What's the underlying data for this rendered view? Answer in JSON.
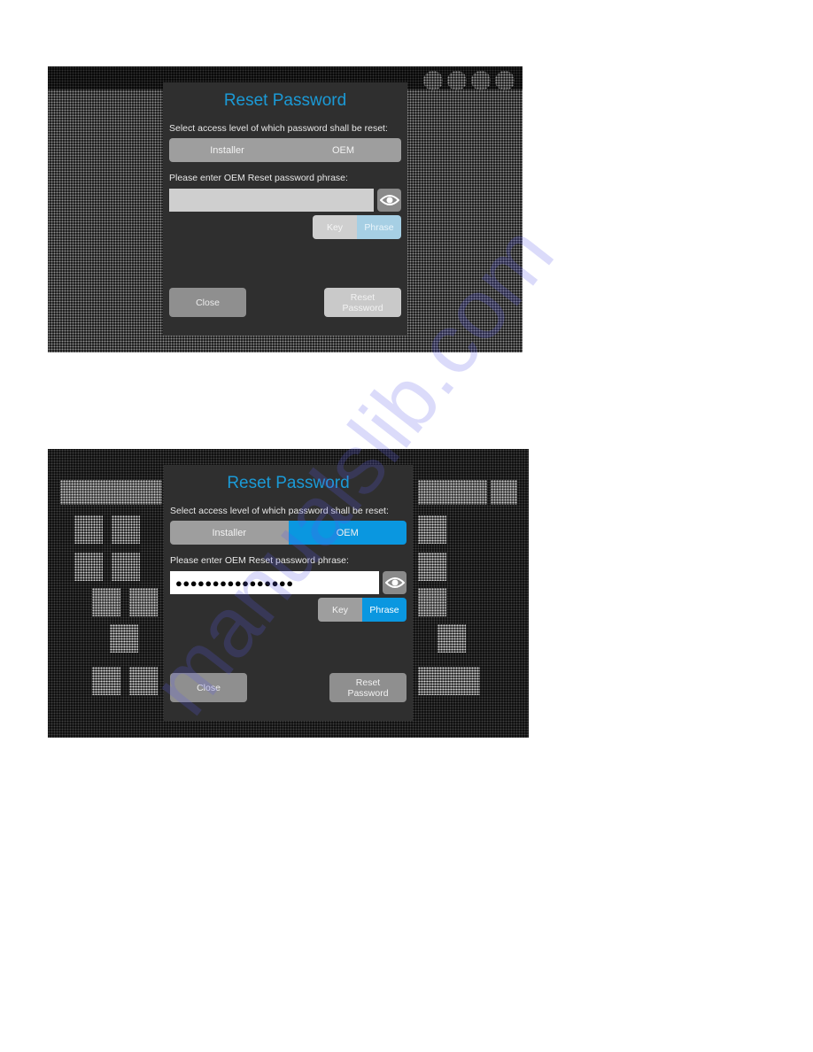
{
  "screens": [
    {
      "state": "default",
      "dialog": {
        "title": "Reset Password",
        "access_label": "Select access level of which password shall be reset:",
        "access_options": [
          {
            "label": "Installer",
            "selected": false
          },
          {
            "label": "OEM",
            "selected": false
          }
        ],
        "phrase_label": "Please enter OEM Reset password phrase:",
        "password_value": "",
        "password_placeholder": "",
        "reveal_icon": "eye-icon",
        "mode_options": [
          {
            "label": "Key",
            "selected": false
          },
          {
            "label": "Phrase",
            "selected": true
          }
        ],
        "close_label": "Close",
        "reset_label_line1": "Reset",
        "reset_label_line2": "Password",
        "reset_enabled": false
      }
    },
    {
      "state": "oem-selected",
      "dialog": {
        "title": "Reset Password",
        "access_label": "Select access level of which password shall be reset:",
        "access_options": [
          {
            "label": "Installer",
            "selected": false
          },
          {
            "label": "OEM",
            "selected": true
          }
        ],
        "phrase_label": "Please enter OEM Reset password phrase:",
        "password_value": "●●●●●●●●●●●●●●●●",
        "password_placeholder": "",
        "reveal_icon": "eye-icon",
        "mode_options": [
          {
            "label": "Key",
            "selected": false
          },
          {
            "label": "Phrase",
            "selected": true
          }
        ],
        "close_label": "Close",
        "reset_label_line1": "Reset",
        "reset_label_line2": "Password",
        "reset_enabled": true
      }
    }
  ],
  "colors": {
    "accent": "#0a97e0",
    "title": "#1b9ad6",
    "dialog_bg": "#2f2f2f",
    "button_gray": "#8f8f8f"
  },
  "watermark": "manualslib.com"
}
